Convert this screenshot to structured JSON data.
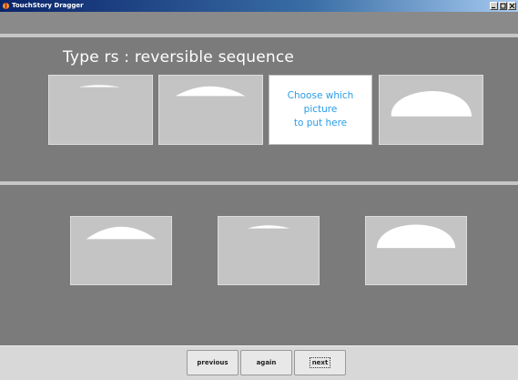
{
  "window": {
    "title": "TouchStory Dragger"
  },
  "prompt": {
    "text": "Type rs : reversible sequence"
  },
  "sequence": {
    "slots": [
      {
        "kind": "picture",
        "icon": "dome-picture-icon",
        "dome_fill": 0.25
      },
      {
        "kind": "picture",
        "icon": "dome-picture-icon",
        "dome_fill": 0.5
      },
      {
        "kind": "placeholder",
        "lines": [
          "Choose which",
          "picture",
          "to put here"
        ]
      },
      {
        "kind": "picture",
        "icon": "dome-picture-icon",
        "dome_fill": 1.0
      }
    ]
  },
  "choices": [
    {
      "icon": "dome-picture-icon",
      "dome_fill": 0.55
    },
    {
      "icon": "dome-picture-icon",
      "dome_fill": 0.25
    },
    {
      "icon": "dome-picture-icon",
      "dome_fill": 0.75
    }
  ],
  "nav": {
    "previous": "previous",
    "again": "again",
    "next": "next"
  },
  "colors": {
    "background": "#7b7b7b",
    "card": "#c4c4c4",
    "placeholder_text": "#2a9ce8",
    "separator": "#c6c6c6"
  }
}
